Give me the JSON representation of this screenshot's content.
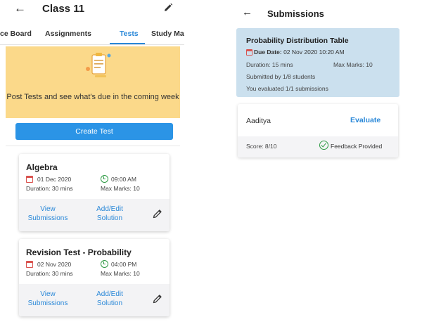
{
  "left_screen": {
    "title": "Class 11",
    "tabs": [
      {
        "label": "ce Board"
      },
      {
        "label": "Assignments"
      },
      {
        "label": "Tests"
      },
      {
        "label": "Study Material"
      }
    ],
    "active_tab": "Tests",
    "banner": {
      "text": "Post Tests and see what's due in the coming week"
    },
    "create_button": "Create Test",
    "tests": [
      {
        "title": "Algebra",
        "date": "01 Dec 2020",
        "time": "09:00 AM",
        "duration": "Duration: 30 mins",
        "max_marks": "Max Marks: 10",
        "view_line1": "View",
        "view_line2": "Submissions",
        "addedit_line1": "Add/Edit",
        "addedit_line2": "Solution"
      },
      {
        "title": "Revision Test - Probability",
        "date": "02 Nov 2020",
        "time": "04:00 PM",
        "duration": "Duration: 30 mins",
        "max_marks": "Max Marks: 10",
        "view_line1": "View",
        "view_line2": "Submissions",
        "addedit_line1": "Add/Edit",
        "addedit_line2": "Solution"
      }
    ]
  },
  "right_screen": {
    "title": "Submissions",
    "test": {
      "title": "Probability Distribution Table",
      "due_label": "Due Date:",
      "due_value": "02 Nov 2020 10:20 AM",
      "duration": "Duration: 15 mins",
      "max_marks": "Max Marks: 10",
      "submitted": "Submitted by 1/8 students",
      "evaluated": "You evaluated 1/1 submissions"
    },
    "submission": {
      "student": "Aaditya",
      "action": "Evaluate",
      "score": "Score: 8/10",
      "status": "Feedback Provided"
    }
  },
  "colors": {
    "accent": "#2a88d8",
    "button": "#2b94e6",
    "banner": "#fbd98a",
    "info_card": "#cbe0ee",
    "calendar": "#d9534f",
    "success": "#2e9a44"
  },
  "icons": [
    "back-arrow-icon",
    "edit-pencil-icon",
    "calendar-icon",
    "clock-icon",
    "check-circle-icon"
  ]
}
